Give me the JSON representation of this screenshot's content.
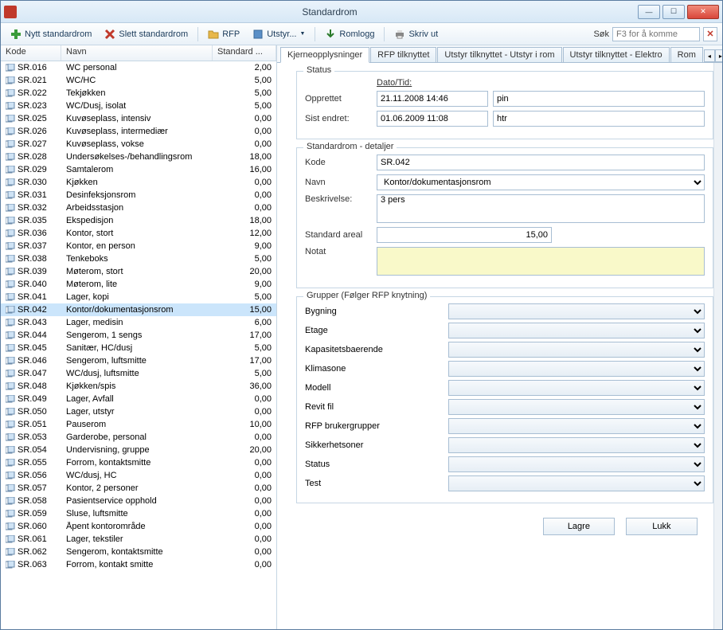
{
  "window": {
    "title": "Standardrom"
  },
  "toolbar": {
    "new": "Nytt standardrom",
    "delete": "Slett standardrom",
    "rfp": "RFP",
    "equip": "Utstyr...",
    "roomlog": "Romlogg",
    "print": "Skriv ut"
  },
  "search": {
    "label": "Søk",
    "placeholder": "F3 for å komme"
  },
  "grid": {
    "headers": {
      "kode": "Kode",
      "navn": "Navn",
      "std": "Standard ..."
    },
    "selected_kode": "SR.042",
    "rows": [
      {
        "kode": "SR.016",
        "navn": "WC personal",
        "std": "2,00"
      },
      {
        "kode": "SR.021",
        "navn": "WC/HC",
        "std": "5,00"
      },
      {
        "kode": "SR.022",
        "navn": "Tekjøkken",
        "std": "5,00"
      },
      {
        "kode": "SR.023",
        "navn": "WC/Dusj, isolat",
        "std": "5,00"
      },
      {
        "kode": "SR.025",
        "navn": "Kuvøseplass, intensiv",
        "std": "0,00"
      },
      {
        "kode": "SR.026",
        "navn": "Kuvøseplass, intermediær",
        "std": "0,00"
      },
      {
        "kode": "SR.027",
        "navn": "Kuvøseplass, vokse",
        "std": "0,00"
      },
      {
        "kode": "SR.028",
        "navn": "Undersøkelses-/behandlingsrom",
        "std": "18,00"
      },
      {
        "kode": "SR.029",
        "navn": "Samtalerom",
        "std": "16,00"
      },
      {
        "kode": "SR.030",
        "navn": "Kjøkken",
        "std": "0,00"
      },
      {
        "kode": "SR.031",
        "navn": "Desinfeksjonsrom",
        "std": "0,00"
      },
      {
        "kode": "SR.032",
        "navn": "Arbeidsstasjon",
        "std": "0,00"
      },
      {
        "kode": "SR.035",
        "navn": "Ekspedisjon",
        "std": "18,00"
      },
      {
        "kode": "SR.036",
        "navn": "Kontor, stort",
        "std": "12,00"
      },
      {
        "kode": "SR.037",
        "navn": "Kontor, en person",
        "std": "9,00"
      },
      {
        "kode": "SR.038",
        "navn": "Tenkeboks",
        "std": "5,00"
      },
      {
        "kode": "SR.039",
        "navn": "Møterom, stort",
        "std": "20,00"
      },
      {
        "kode": "SR.040",
        "navn": "Møterom, lite",
        "std": "9,00"
      },
      {
        "kode": "SR.041",
        "navn": "Lager, kopi",
        "std": "5,00"
      },
      {
        "kode": "SR.042",
        "navn": "Kontor/dokumentasjonsrom",
        "std": "15,00"
      },
      {
        "kode": "SR.043",
        "navn": "Lager, medisin",
        "std": "6,00"
      },
      {
        "kode": "SR.044",
        "navn": "Sengerom, 1 sengs",
        "std": "17,00"
      },
      {
        "kode": "SR.045",
        "navn": "Sanitær, HC/dusj",
        "std": "5,00"
      },
      {
        "kode": "SR.046",
        "navn": "Sengerom, luftsmitte",
        "std": "17,00"
      },
      {
        "kode": "SR.047",
        "navn": "WC/dusj, luftsmitte",
        "std": "5,00"
      },
      {
        "kode": "SR.048",
        "navn": "Kjøkken/spis",
        "std": "36,00"
      },
      {
        "kode": "SR.049",
        "navn": "Lager, Avfall",
        "std": "0,00"
      },
      {
        "kode": "SR.050",
        "navn": "Lager, utstyr",
        "std": "0,00"
      },
      {
        "kode": "SR.051",
        "navn": "Pauserom",
        "std": "10,00"
      },
      {
        "kode": "SR.053",
        "navn": "Garderobe, personal",
        "std": "0,00"
      },
      {
        "kode": "SR.054",
        "navn": "Undervisning, gruppe",
        "std": "20,00"
      },
      {
        "kode": "SR.055",
        "navn": "Forrom, kontaktsmitte",
        "std": "0,00"
      },
      {
        "kode": "SR.056",
        "navn": "WC/dusj, HC",
        "std": "0,00"
      },
      {
        "kode": "SR.057",
        "navn": "Kontor, 2 personer",
        "std": "0,00"
      },
      {
        "kode": "SR.058",
        "navn": "Pasientservice opphold",
        "std": "0,00"
      },
      {
        "kode": "SR.059",
        "navn": "Sluse, luftsmitte",
        "std": "0,00"
      },
      {
        "kode": "SR.060",
        "navn": "Åpent kontorområde",
        "std": "0,00"
      },
      {
        "kode": "SR.061",
        "navn": "Lager, tekstiler",
        "std": "0,00"
      },
      {
        "kode": "SR.062",
        "navn": "Sengerom, kontaktsmitte",
        "std": "0,00"
      },
      {
        "kode": "SR.063",
        "navn": "Forrom, kontakt smitte",
        "std": "0,00"
      }
    ]
  },
  "tabs": {
    "t1": "Kjerneopplysninger",
    "t2": "RFP tilknyttet",
    "t3": "Utstyr tilknyttet - Utstyr i rom",
    "t4": "Utstyr tilknyttet - Elektro",
    "t5": "Rom"
  },
  "status": {
    "legend": "Status",
    "dato_tid": "Dato/Tid:",
    "opprettet_label": "Opprettet",
    "opprettet_dt": "21.11.2008 14:46",
    "opprettet_by": "pin",
    "endret_label": "Sist endret:",
    "endret_dt": "01.06.2009 11:08",
    "endret_by": "htr"
  },
  "details": {
    "legend": "Standardrom - detaljer",
    "kode_label": "Kode",
    "kode_value": "SR.042",
    "navn_label": "Navn",
    "navn_value": "Kontor/dokumentasjonsrom",
    "beskriv_label": "Beskrivelse:",
    "beskriv_value": "3 pers",
    "areal_label": "Standard areal",
    "areal_value": "15,00",
    "notat_label": "Notat",
    "notat_value": ""
  },
  "groups": {
    "legend": "Grupper (Følger RFP knytning)",
    "items": [
      "Bygning",
      "Etage",
      "Kapasitetsbaerende",
      "Klimasone",
      "Modell",
      "Revit fil",
      "RFP brukergrupper",
      "Sikkerhetsoner",
      "Status",
      "Test"
    ]
  },
  "buttons": {
    "save": "Lagre",
    "close": "Lukk"
  }
}
